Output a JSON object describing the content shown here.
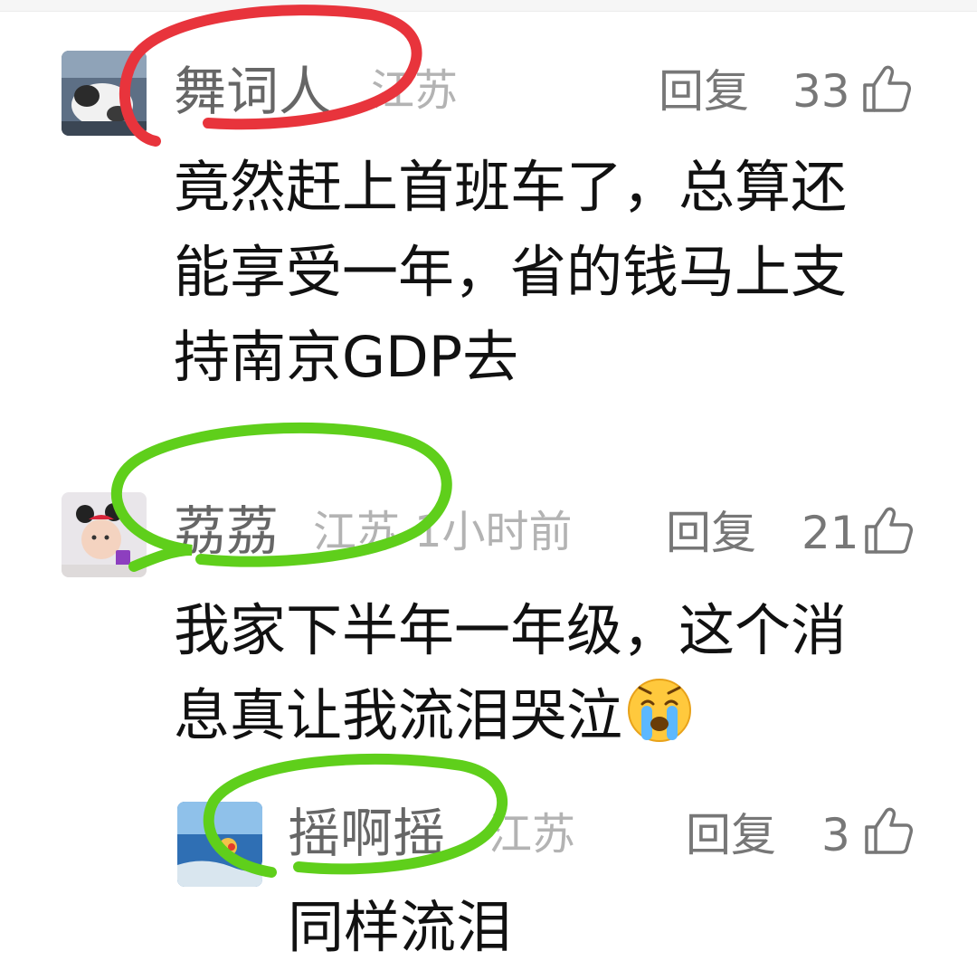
{
  "comments": [
    {
      "username": "舞词人",
      "location": "江苏",
      "time": "",
      "reply_label": "回复",
      "likes": "33",
      "lines": [
        "竟然赶上首班车了，总算还",
        "能享受一年，省的钱马上支",
        "持南京GDP去"
      ],
      "highlight_color": "#e8343c"
    },
    {
      "username": "荔荔",
      "location": "江苏",
      "time": "1小时前",
      "reply_label": "回复",
      "likes": "21",
      "lines": [
        "我家下半年一年级，这个消",
        "息真让我流泪哭泣"
      ],
      "emoji": "loudly-crying-face",
      "highlight_color": "#5fcf1b"
    },
    {
      "username": "摇啊摇",
      "location": "江苏",
      "time": "",
      "reply_label": "回复",
      "likes": "3",
      "lines": [
        "同样流泪"
      ],
      "highlight_color": "#5fcf1b"
    }
  ]
}
